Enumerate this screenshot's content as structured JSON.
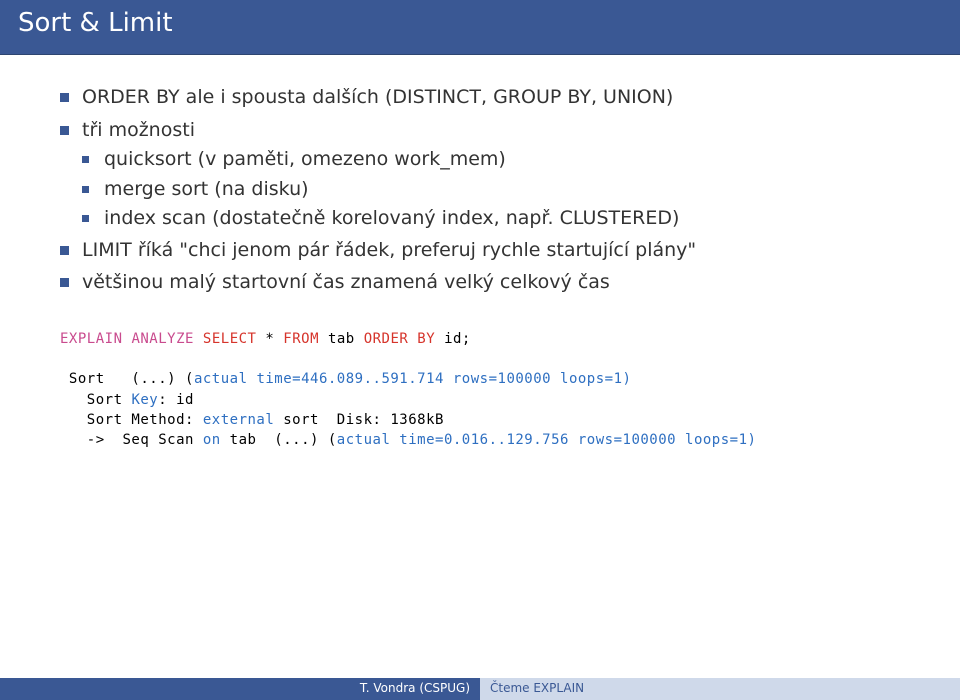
{
  "title": "Sort & Limit",
  "bullets": {
    "b0": "ORDER BY ale i spousta dalších (DISTINCT, GROUP BY, UNION)",
    "b1": "tři možnosti",
    "b1a": "quicksort (v paměti, omezeno work_mem)",
    "b1b": "merge sort (na disku)",
    "b1c": "index scan (dostatečně korelovaný index, např. CLUSTERED)",
    "b2": "LIMIT říká \"chci jenom pár řádek, preferuj rychle startující plány\"",
    "b3": "většinou malý startovní čas znamená velký celkový čas"
  },
  "sql": {
    "explain": "EXPLAIN",
    "analyze": "ANALYZE",
    "select": "SELECT",
    "star": "*",
    "from": "FROM",
    "tab": "tab",
    "order": "ORDER BY",
    "id": "id;"
  },
  "plan": {
    "l1a": " Sort   (...) (",
    "l1b": "actual",
    "l1c": " time=446.089..591.714 rows=100000 loops=1)",
    "l2a": "   Sort ",
    "l2b": "Key",
    "l2c": ": id",
    "l3a": "   Sort Method: ",
    "l3b": "external",
    "l3c": " sort  Disk: 1368kB",
    "l4a": "   ->  Seq Scan ",
    "l4b": "on",
    "l4c": " tab  (...) (",
    "l4d": "actual",
    "l4e": " time=0.016..129.756 rows=100000 loops=1)"
  },
  "footer": {
    "left": "T. Vondra (CSPUG)",
    "right": "Čteme EXPLAIN"
  }
}
